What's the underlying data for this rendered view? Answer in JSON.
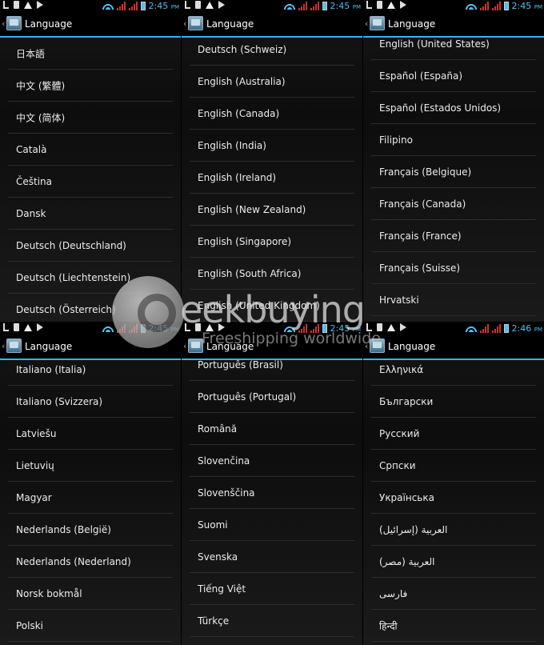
{
  "colors": {
    "accent": "#33b5e5",
    "time": "#4cc0ef",
    "signal": "#cc3333"
  },
  "panels": [
    {
      "time": "2:45",
      "ampm": "PM",
      "title": "Language",
      "items": [
        "日本語",
        "中文 (繁體)",
        "中文 (简体)",
        "Català",
        "Čeština",
        "Dansk",
        "Deutsch (Deutschland)",
        "Deutsch (Liechtenstein)",
        "Deutsch (Österreich)"
      ]
    },
    {
      "time": "2:45",
      "ampm": "PM",
      "title": "Language",
      "items": [
        "Deutsch (Schweiz)",
        "English (Australia)",
        "English (Canada)",
        "English (India)",
        "English (Ireland)",
        "English (New Zealand)",
        "English (Singapore)",
        "English (South Africa)",
        "English (United Kingdom)"
      ]
    },
    {
      "time": "2:45",
      "ampm": "PM",
      "title": "Language",
      "items": [
        "English (United States)",
        "Español (España)",
        "Español (Estados Unidos)",
        "Filipino",
        "Français (Belgique)",
        "Français (Canada)",
        "Français (France)",
        "Français (Suisse)",
        "Hrvatski"
      ]
    },
    {
      "time": "2:45",
      "ampm": "PM",
      "title": "Language",
      "items": [
        "Italiano (Italia)",
        "Italiano (Svizzera)",
        "Latviešu",
        "Lietuvių",
        "Magyar",
        "Nederlands (België)",
        "Nederlands (Nederland)",
        "Norsk bokmål",
        "Polski"
      ]
    },
    {
      "time": "2:45",
      "ampm": "PM",
      "title": "Language",
      "items": [
        "Português (Brasil)",
        "Português (Portugal)",
        "Română",
        "Slovenčina",
        "Slovenščina",
        "Suomi",
        "Svenska",
        "Tiếng Việt",
        "Türkçe"
      ]
    },
    {
      "time": "2:46",
      "ampm": "PM",
      "title": "Language",
      "items": [
        "Ελληνικά",
        "Български",
        "Русский",
        "Српски",
        "Українська",
        "العربية (إسرائيل)",
        "العربية (مصر)",
        "فارسی",
        "हिन्दी"
      ]
    }
  ],
  "watermark": {
    "brand": "eekbuying",
    "tagline": "Freeshipping worldwide"
  }
}
